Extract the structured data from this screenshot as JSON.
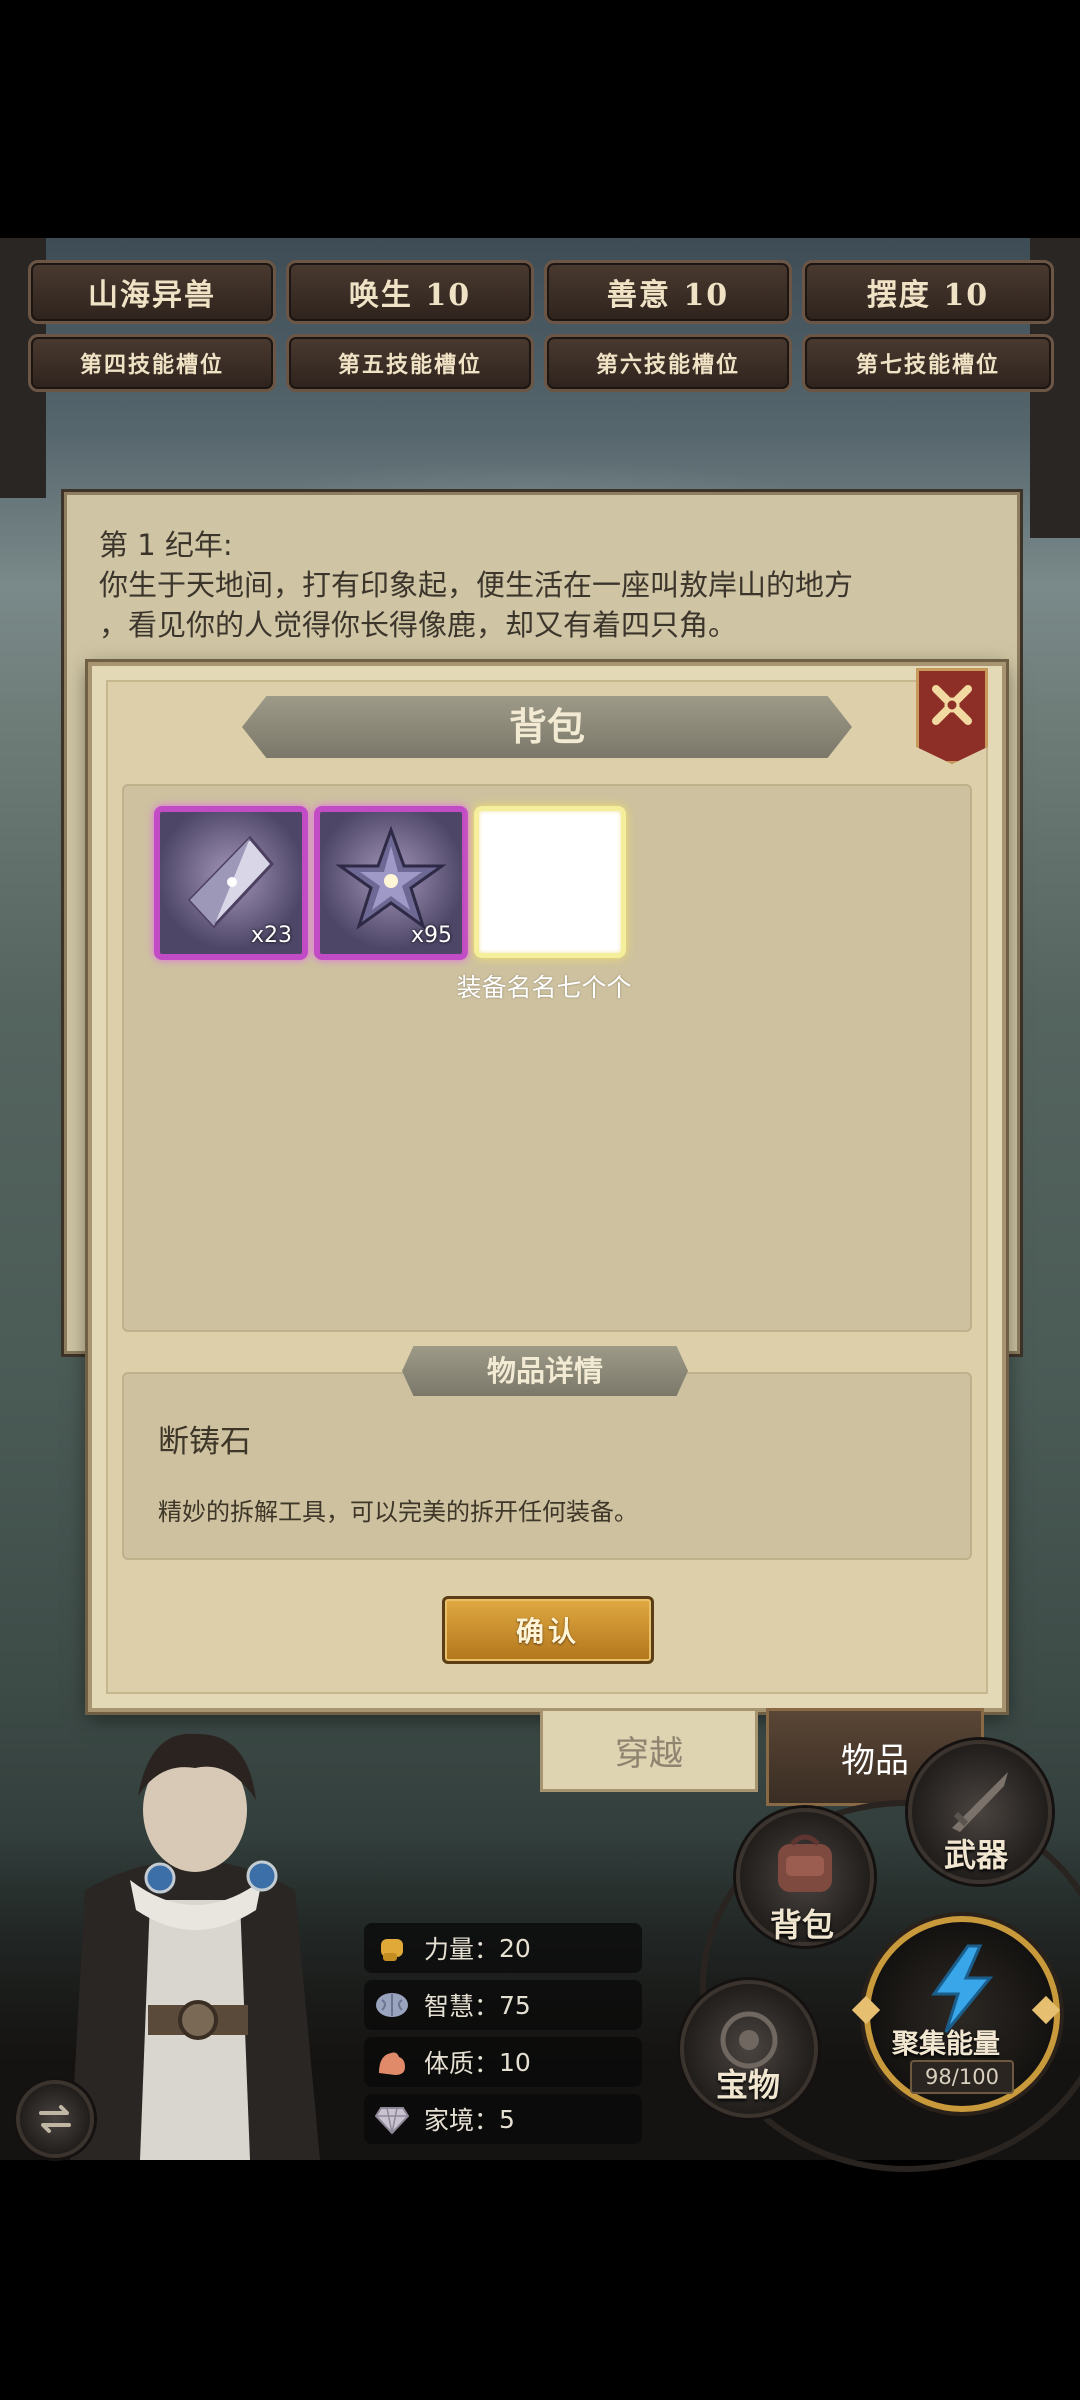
{
  "top_buttons": {
    "row1": [
      "山海异兽",
      "唤生 10",
      "善意 10",
      "摆度 10"
    ],
    "row2": [
      "第四技能槽位",
      "第五技能槽位",
      "第六技能槽位",
      "第七技能槽位"
    ]
  },
  "story": {
    "era": "第 1 纪年:",
    "line1": "你生于天地间，打有印象起，便生活在一座叫敖岸山的地方",
    "line2": "，看见你的人觉得你长得像鹿，却又有着四只角。"
  },
  "backpack": {
    "title": "背包",
    "items": [
      {
        "name": "crystal",
        "qty": "x23"
      },
      {
        "name": "star",
        "qty": "x95"
      },
      {
        "name": "empty",
        "qty": ""
      }
    ],
    "selected_label": "装备名名七个个",
    "detail_title": "物品详情",
    "detail_name": "断铸石",
    "detail_desc": "精妙的拆解工具，可以完美的拆开任何装备。",
    "confirm_label": "确认"
  },
  "tabs": {
    "travel": "穿越",
    "items": "物品"
  },
  "stats": [
    {
      "label": "力量：",
      "value": "20"
    },
    {
      "label": "智慧：",
      "value": "75"
    },
    {
      "label": "体质：",
      "value": "10"
    },
    {
      "label": "家境：",
      "value": "5"
    }
  ],
  "menu": {
    "weapon": "武器",
    "bag": "背包",
    "treasure": "宝物",
    "gather": "聚集能量",
    "energy": "98/100"
  },
  "colors": {
    "accent_gold": "#c99a3b",
    "close_red": "#8e2f27",
    "slot_purple": "#c24bc6"
  }
}
